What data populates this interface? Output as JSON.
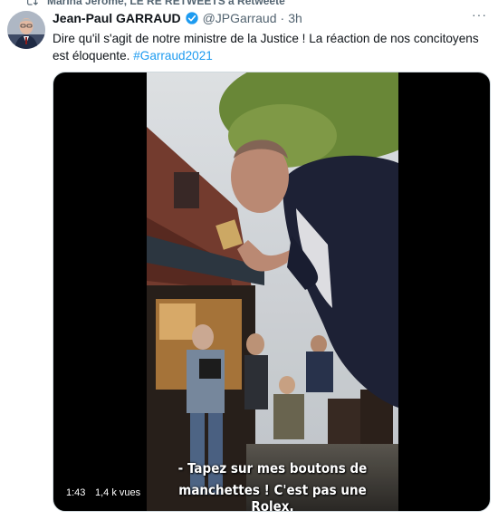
{
  "retweet": {
    "label": "Marina Jérôme, LE RÉ RETWEETS a Retweeté"
  },
  "tweet": {
    "author_name": "Jean-Paul GARRAUD",
    "handle": "@JPGarraud",
    "separator": "·",
    "time": "3h",
    "more": "···",
    "text_main": "Dire qu'il s'agit de notre ministre de la Justice ! La réaction de nos concitoyens est éloquente. ",
    "hashtag": "#Garraud2021"
  },
  "video": {
    "subtitle_line1": "- Tapez sur mes boutons de",
    "subtitle_line2": "manchettes ! C'est pas une Rolex.",
    "duration": "1:43",
    "views": "1,4 k vues"
  },
  "colors": {
    "accent": "#1d9bf0",
    "text": "#0f1419",
    "secondary": "#536471"
  },
  "icons": {
    "retweet": "retweet-icon",
    "verified": "verified-badge-icon",
    "more": "more-options-icon"
  }
}
